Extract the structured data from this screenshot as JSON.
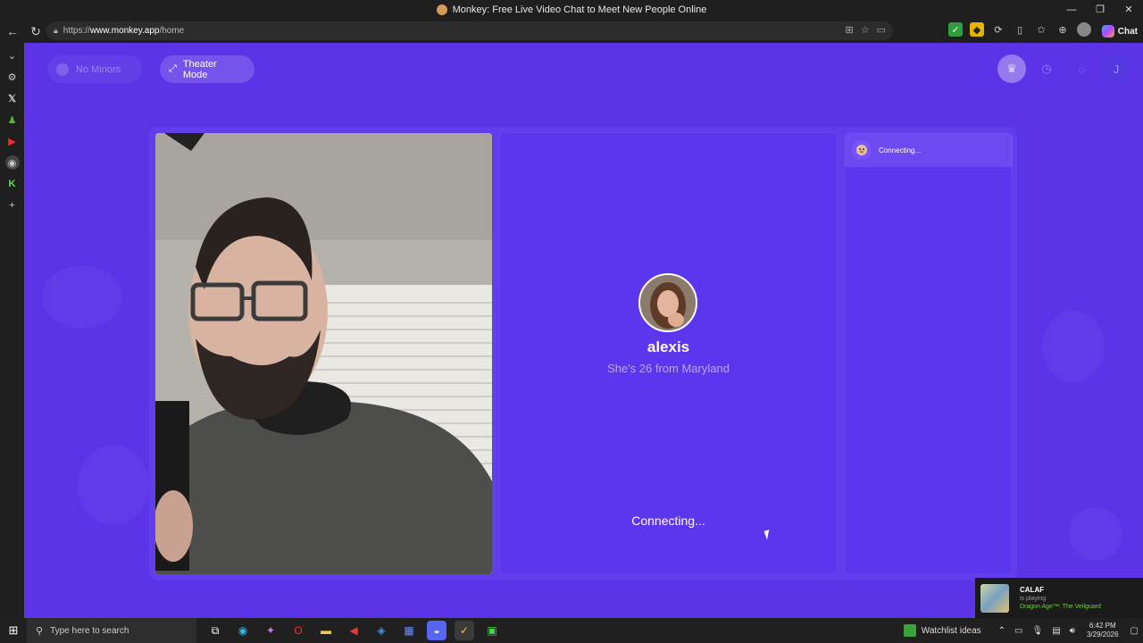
{
  "browser": {
    "window_title": "Monkey: Free Live Video Chat to Meet New People Online",
    "url_prefix": "https://",
    "url_host": "www.monkey.app",
    "url_path": "/home",
    "chat_label": "Chat"
  },
  "header": {
    "no_minors_label": "No Minors",
    "theater_mode_label": "Theater Mode",
    "profile_initial": "J"
  },
  "partner": {
    "name": "alexis",
    "subtitle": "She's 26 from Maryland",
    "status": "Connecting..."
  },
  "chat_panel": {
    "status": "Connecting..."
  },
  "notification": {
    "user": "CALAF",
    "activity": "is playing",
    "game": "Dragon Age™: The Veilguard"
  },
  "taskbar": {
    "search_placeholder": "Type here to search",
    "watchlist_label": "Watchlist ideas",
    "time": "6:42 PM",
    "date": "3/29/2026"
  },
  "colors": {
    "page_background": "#5a34e6",
    "panel_background": "#5c35ef"
  }
}
